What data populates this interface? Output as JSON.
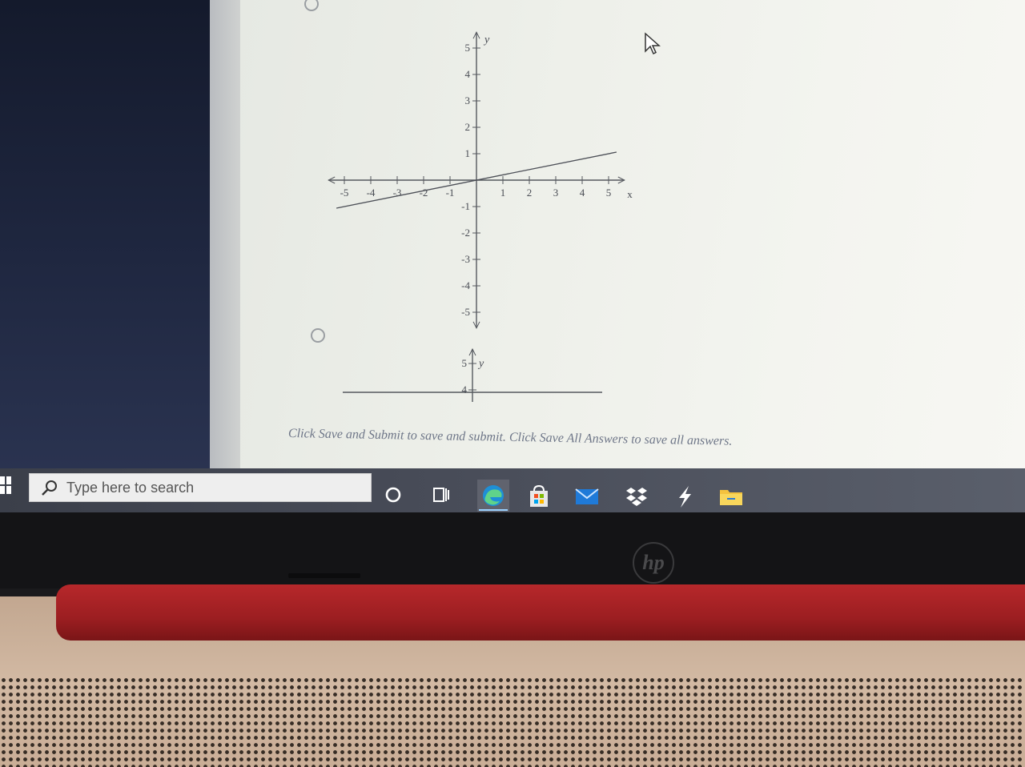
{
  "graph_a": {
    "y_axis_label": "y",
    "x_axis_label": "x",
    "x_ticks": [
      "-5",
      "-4",
      "-3",
      "-2",
      "-1",
      "1",
      "2",
      "3",
      "4",
      "5"
    ],
    "y_ticks": [
      "5",
      "4",
      "3",
      "2",
      "1",
      "-1",
      "-2",
      "-3",
      "-4",
      "-5"
    ],
    "line": {
      "slope": 0.2,
      "intercept": 0,
      "x_range": [
        -5.3,
        5.3
      ]
    }
  },
  "graph_b": {
    "y_axis_label": "y",
    "y_ticks": [
      "5",
      "4"
    ]
  },
  "footer_note": "Click Save and Submit to save and submit. Click Save All Answers to save all answers.",
  "taskbar": {
    "search_placeholder": "Type here to search",
    "icons": [
      "cortana-icon",
      "task-view-icon",
      "edge-icon",
      "store-icon",
      "mail-icon",
      "dropbox-icon",
      "bolt-icon",
      "file-explorer-icon"
    ]
  },
  "laptop": {
    "brand_logo": "hp"
  }
}
